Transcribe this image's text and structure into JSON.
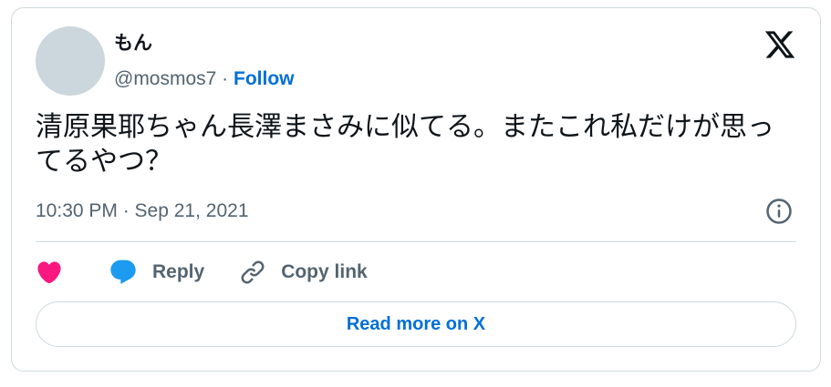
{
  "author": {
    "display_name": "もん",
    "handle": "@mosmos7",
    "separator": " · ",
    "follow_label": "Follow"
  },
  "tweet": {
    "text": "清原果耶ちゃん長澤まさみに似てる。またこれ私だけが思ってるやつ？",
    "timestamp": "10:30 PM · Sep 21, 2021"
  },
  "actions": {
    "reply_label": "Reply",
    "copy_link_label": "Copy link"
  },
  "footer": {
    "read_more_label": "Read more on X"
  },
  "icons": {
    "logo": "x-logo-icon",
    "info": "info-icon",
    "like": "heart-icon",
    "reply": "reply-bubble-icon",
    "copy": "link-icon"
  },
  "colors": {
    "accent": "#006fd6",
    "heart": "#f91880",
    "reply": "#1d9bf0",
    "muted": "#536471",
    "border": "#cfd9de",
    "avatar": "#ccd6dd"
  }
}
